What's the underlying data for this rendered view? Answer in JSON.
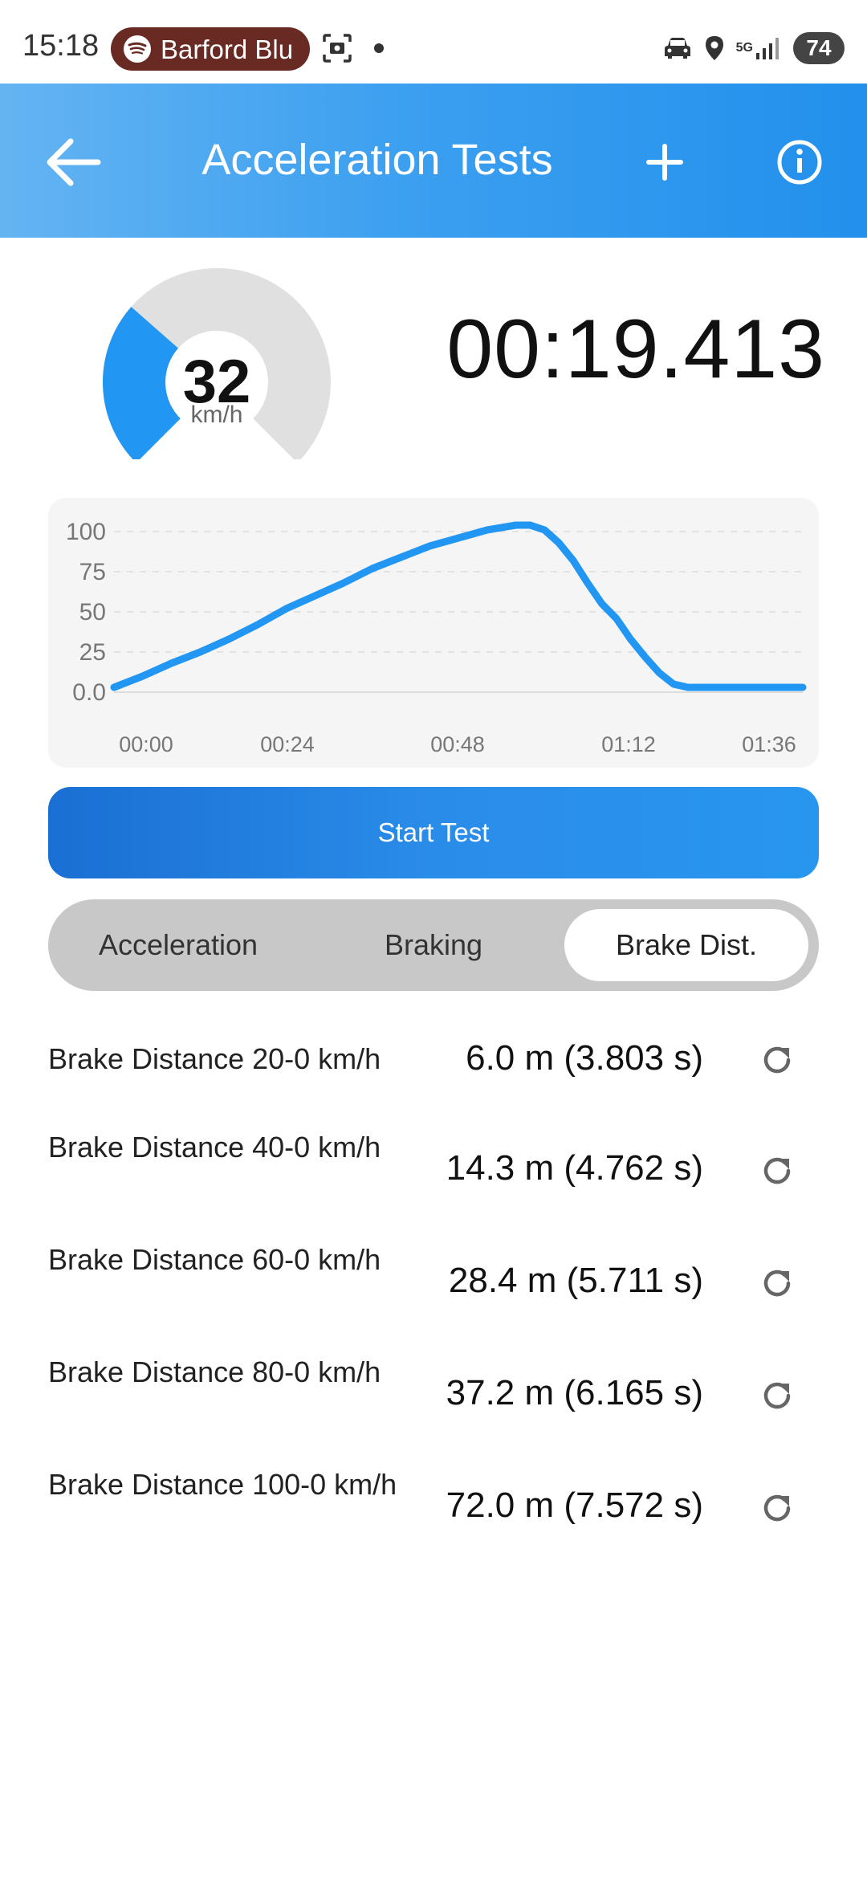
{
  "status_bar": {
    "time": "15:18",
    "media_pill": "Barford Blu",
    "network": "5G",
    "battery": "74"
  },
  "app_bar": {
    "title": "Acceleration Tests",
    "icons": [
      "arrow-back-icon",
      "plus-icon",
      "info-icon"
    ]
  },
  "gauge": {
    "value": "32",
    "unit": "km/h",
    "max": 100,
    "accent_color": "#2196f3"
  },
  "timer": "00:19.413",
  "chart_data": {
    "type": "line",
    "x_tick_labels": [
      "00:00",
      "00:24",
      "00:48",
      "01:12",
      "01:36"
    ],
    "y_tick_labels": [
      "100",
      "75",
      "50",
      "25",
      "0.0"
    ],
    "y_ticks": [
      100,
      75,
      50,
      25,
      0
    ],
    "xlim_seconds": [
      0,
      96
    ],
    "ylim": [
      0,
      100
    ],
    "grid": true,
    "line_color": "#2196f3",
    "x_seconds": [
      0,
      4,
      8,
      12,
      16,
      20,
      24,
      28,
      32,
      36,
      40,
      44,
      48,
      52,
      56,
      58,
      60,
      62,
      64,
      66,
      68,
      70,
      72,
      74,
      76,
      78,
      80,
      82,
      84,
      88,
      92,
      96
    ],
    "y_values": [
      3,
      10,
      18,
      25,
      33,
      42,
      52,
      60,
      68,
      77,
      84,
      91,
      96,
      101,
      104,
      104,
      101,
      93,
      82,
      68,
      55,
      46,
      33,
      22,
      12,
      5,
      3,
      3,
      3,
      3,
      3,
      3
    ]
  },
  "start_button": "Start Test",
  "tabs": [
    {
      "label": "Acceleration",
      "selected": false
    },
    {
      "label": "Braking",
      "selected": false
    },
    {
      "label": "Brake Dist.",
      "selected": true
    }
  ],
  "results": [
    {
      "label": "Brake Distance 20-0 km/h",
      "value": "6.0 m (3.803 s)"
    },
    {
      "label": "Brake Distance 40-0 km/h",
      "value": "14.3 m (4.762 s)"
    },
    {
      "label": "Brake Distance 60-0 km/h",
      "value": "28.4 m (5.711 s)"
    },
    {
      "label": "Brake Distance 80-0 km/h",
      "value": "37.2 m (6.165 s)"
    },
    {
      "label": "Brake Distance 100-0 km/h",
      "value": "72.0 m (7.572 s)"
    }
  ]
}
